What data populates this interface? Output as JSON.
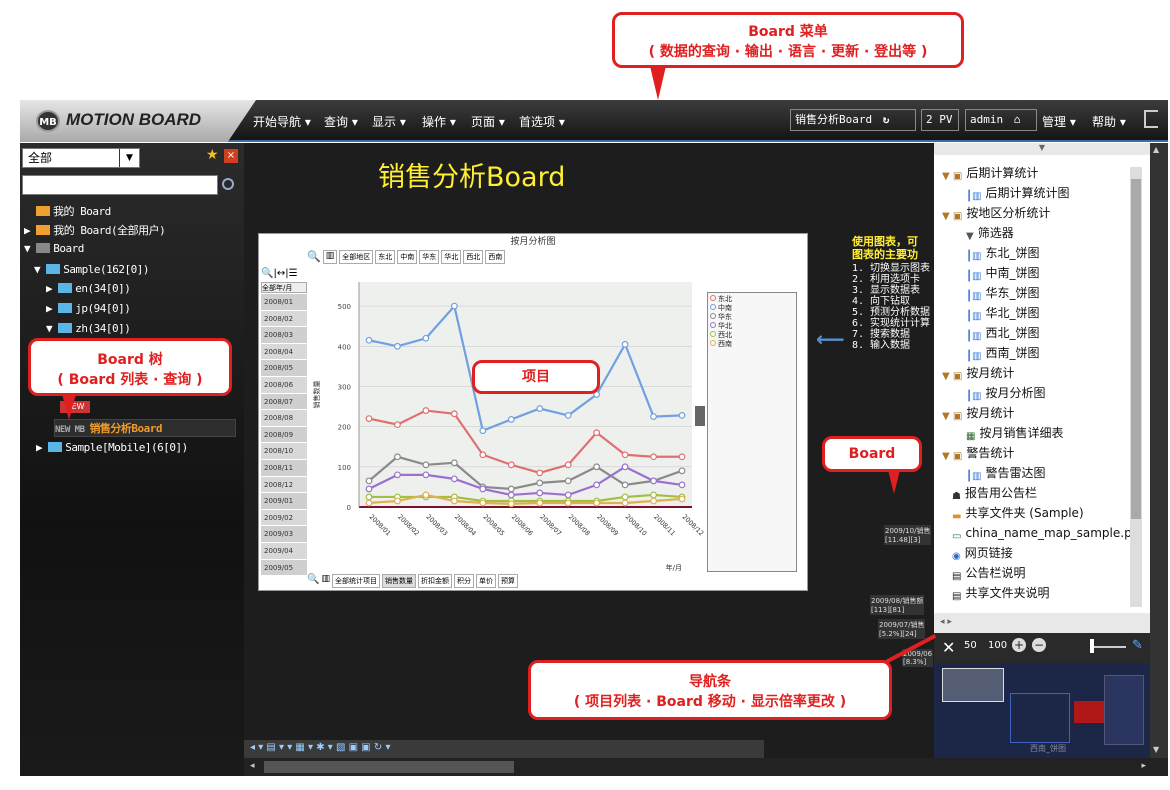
{
  "menubar": {
    "logo_text": "MOTION BOARD",
    "logo_badge": "MB",
    "items": [
      "开始导航 ▾",
      "查询 ▾",
      "显示 ▾",
      "操作 ▾",
      "页面 ▾",
      "首选项 ▾"
    ],
    "board_name": "销售分析Board",
    "reload_icon": "↻",
    "pv": "2 PV",
    "user": "admin",
    "home_icon": "⌂",
    "admin_menu": "管理 ▾",
    "help_menu": "帮助 ▾"
  },
  "left_panel": {
    "filter_value": "全部",
    "tree": [
      "我的 Board",
      "我的 Board(全部用户)",
      "Board",
      "Sample(162[0])",
      "en(34[0])",
      "jp(94[0])",
      "zh(34[0])",
      "销售分析Board",
      "Sample[Mobile](6[0])"
    ],
    "new_badge": "NEW"
  },
  "canvas": {
    "board_title": "销售分析Board",
    "info_heading_1": "使用图表，可",
    "info_heading_2": "图表的主要功",
    "info_lines": [
      "1. 切换显示图表",
      "2. 利用选项卡",
      "3. 显示数据表",
      "4. 向下钻取",
      "5. 预测分析数据",
      "6. 实现统计计算",
      "7. 搜索数据",
      "8. 输入数据"
    ],
    "map_labels": [
      "2009/10/销售\n[11.48][3]",
      "2009/08/销售额\n[113][81]",
      "2009/07/销售\n[5.2%][24]",
      "2009/06\n[8.3%]"
    ]
  },
  "chart": {
    "title": "按月分析图",
    "toolbar_tabs": [
      "全部地区",
      "东北",
      "中南",
      "华东",
      "华北",
      "西北",
      "西南"
    ],
    "left_header": "全部年/月",
    "bottom_tabs": [
      "全部统计项目",
      "销售数量",
      "折扣金额",
      "积分",
      "单价",
      "预算"
    ],
    "xlabel": "年/月",
    "ylabel": "销售数量"
  },
  "chart_data": {
    "type": "line",
    "title": "按月分析图",
    "xlabel": "年/月",
    "ylabel": "销售数量",
    "categories": [
      "2008/01",
      "2008/02",
      "2008/03",
      "2008/04",
      "2008/05",
      "2008/06",
      "2008/07",
      "2008/08",
      "2008/09",
      "2008/10",
      "2008/11",
      "2008/12"
    ],
    "ylim": [
      0,
      560
    ],
    "yticks": [
      0,
      100,
      200,
      300,
      400,
      500
    ],
    "series": [
      {
        "name": "东北",
        "color": "#e07070",
        "values": [
          220,
          205,
          240,
          232,
          130,
          105,
          85,
          105,
          185,
          130,
          125,
          125
        ]
      },
      {
        "name": "中南",
        "color": "#70a0e0",
        "values": [
          415,
          400,
          420,
          500,
          190,
          218,
          245,
          228,
          280,
          405,
          225,
          228
        ]
      },
      {
        "name": "华东",
        "color": "#8a8a8a",
        "values": [
          65,
          125,
          105,
          110,
          50,
          45,
          60,
          65,
          100,
          55,
          65,
          90
        ]
      },
      {
        "name": "华北",
        "color": "#9a70d0",
        "values": [
          45,
          80,
          80,
          70,
          45,
          30,
          35,
          30,
          55,
          100,
          65,
          55
        ]
      },
      {
        "name": "西北",
        "color": "#a0c040",
        "values": [
          25,
          25,
          25,
          25,
          15,
          15,
          15,
          15,
          15,
          25,
          30,
          25
        ]
      },
      {
        "name": "西南",
        "color": "#e0b050",
        "values": [
          10,
          15,
          30,
          15,
          10,
          8,
          10,
          10,
          10,
          10,
          15,
          20
        ]
      }
    ],
    "left_rows": [
      "2008/01",
      "2008/02",
      "2008/03",
      "2008/04",
      "2008/05",
      "2008/06",
      "2008/07",
      "2008/08",
      "2008/09",
      "2008/10",
      "2008/11",
      "2008/12",
      "2009/01",
      "2009/02",
      "2009/03",
      "2009/04",
      "2009/05"
    ]
  },
  "right_panel": {
    "items": [
      {
        "label": "后期计算统计",
        "icon": "group"
      },
      {
        "label": "后期计算统计图",
        "icon": "chart"
      },
      {
        "label": "按地区分析统计",
        "icon": "group"
      },
      {
        "label": "筛选器",
        "icon": "filter"
      },
      {
        "label": "东北_饼图",
        "icon": "chart"
      },
      {
        "label": "中南_饼图",
        "icon": "chart"
      },
      {
        "label": "华东_饼图",
        "icon": "chart"
      },
      {
        "label": "华北_饼图",
        "icon": "chart"
      },
      {
        "label": "西北_饼图",
        "icon": "chart"
      },
      {
        "label": "西南_饼图",
        "icon": "chart"
      },
      {
        "label": "按月统计",
        "icon": "group"
      },
      {
        "label": "按月分析图",
        "icon": "chart"
      },
      {
        "label": "按月统计",
        "icon": "group"
      },
      {
        "label": "按月销售详细表",
        "icon": "table"
      },
      {
        "label": "警告统计",
        "icon": "group"
      },
      {
        "label": "警告雷达图",
        "icon": "chart"
      },
      {
        "label": "报告用公告栏",
        "icon": "board"
      },
      {
        "label": "共享文件夹 (Sample)",
        "icon": "folder"
      },
      {
        "label": "china_name_map_sample.p",
        "icon": "map"
      },
      {
        "label": "网页链接",
        "icon": "link"
      },
      {
        "label": "公告栏说明",
        "icon": "doc"
      },
      {
        "label": "共享文件夹说明",
        "icon": "doc"
      }
    ],
    "zoom_50": "50",
    "zoom_100": "100",
    "map_caption": "西南_饼图"
  },
  "callouts": {
    "menu_title": "Board 菜单",
    "menu_desc": "( 数据的查询 · 输出 · 语言 · 更新 · 登出等 )",
    "tree_title": "Board 树",
    "tree_desc": "( Board 列表 · 查询 )",
    "item": "项目",
    "board": "Board",
    "nav_title": "导航条",
    "nav_desc": "( 项目列表 · Board 移动 · 显示倍率更改 )"
  },
  "colors": {
    "accent_yellow": "#ffee33",
    "callout_red": "#e02020",
    "chart_axis": "#7a1030"
  }
}
